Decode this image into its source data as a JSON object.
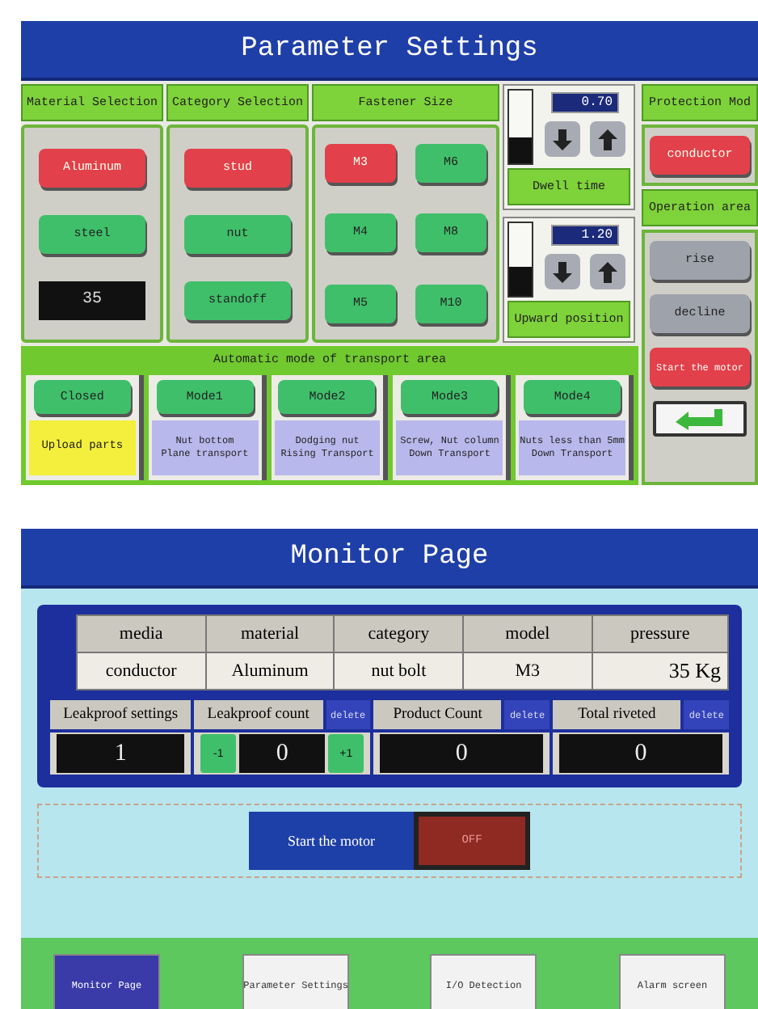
{
  "parameter_screen": {
    "title": "Parameter Settings",
    "material_selection": {
      "heading": "Material Selection",
      "options": [
        {
          "label": "Aluminum",
          "selected": true
        },
        {
          "label": "steel",
          "selected": false
        }
      ],
      "value": "35"
    },
    "category_selection": {
      "heading": "Category Selection",
      "options": [
        {
          "label": "stud",
          "selected": true
        },
        {
          "label": "nut",
          "selected": false
        },
        {
          "label": "standoff",
          "selected": false
        }
      ]
    },
    "fastener_size": {
      "heading": "Fastener Size",
      "options": [
        {
          "label": "M3",
          "selected": true
        },
        {
          "label": "M6",
          "selected": false
        },
        {
          "label": "M4",
          "selected": false
        },
        {
          "label": "M8",
          "selected": false
        },
        {
          "label": "M5",
          "selected": false
        },
        {
          "label": "M10",
          "selected": false
        }
      ]
    },
    "adjusters": [
      {
        "label": "Dwell time",
        "value": "0.70",
        "level": 0.35
      },
      {
        "label": "Upward position",
        "value": "1.20",
        "level": 0.4
      }
    ],
    "protection_mode": {
      "heading": "Protection Mod",
      "options": [
        {
          "label": "conductor",
          "selected": true
        }
      ]
    },
    "operation_area": {
      "heading": "Operation area",
      "buttons": [
        {
          "kind": "plain",
          "label": "rise"
        },
        {
          "kind": "plain",
          "label": "decline"
        },
        {
          "kind": "alert",
          "label": "Start the motor"
        },
        {
          "kind": "return"
        }
      ]
    },
    "auto_mode": {
      "heading": "Automatic mode of transport area",
      "modes": [
        {
          "label": "Closed",
          "selected": true,
          "description": [
            "Upload parts"
          ]
        },
        {
          "label": "Mode1",
          "selected": false,
          "description": [
            "Nut bottom",
            "Plane transport"
          ]
        },
        {
          "label": "Mode2",
          "selected": false,
          "description": [
            "Dodging nut",
            "Rising Transport"
          ]
        },
        {
          "label": "Mode3",
          "selected": false,
          "description": [
            "Screw, Nut column",
            "Down Transport"
          ]
        },
        {
          "label": "Mode4",
          "selected": false,
          "description": [
            "Nuts less than 5mm",
            "Down Transport"
          ]
        }
      ]
    }
  },
  "monitor_screen": {
    "title": "Monitor Page",
    "summary_table": {
      "columns": [
        "media",
        "material",
        "category",
        "model",
        "pressure"
      ],
      "rows": [
        [
          "conductor",
          "Aluminum",
          "nut bolt",
          "M3",
          "35 Kg"
        ]
      ]
    },
    "counters": [
      {
        "kind": "setting",
        "label": "Leakproof settings",
        "value": "1"
      },
      {
        "kind": "stepper",
        "label": "Leakproof count",
        "value": "0",
        "reset": "delete",
        "decrement": "-1",
        "increment": "+1"
      },
      {
        "kind": "counter",
        "label": "Product Count",
        "value": "0",
        "reset": "delete"
      },
      {
        "kind": "counter",
        "label": "Total riveted",
        "value": "0",
        "reset": "delete"
      }
    ],
    "motor": {
      "label": "Start the motor",
      "state": "OFF",
      "on": false
    },
    "nav": [
      {
        "label": "Monitor Page",
        "selected": true
      },
      {
        "label": "Parameter Settings",
        "selected": false
      },
      {
        "label": "I/O Detection",
        "selected": false
      },
      {
        "label": "Alarm screen",
        "selected": false
      }
    ]
  }
}
